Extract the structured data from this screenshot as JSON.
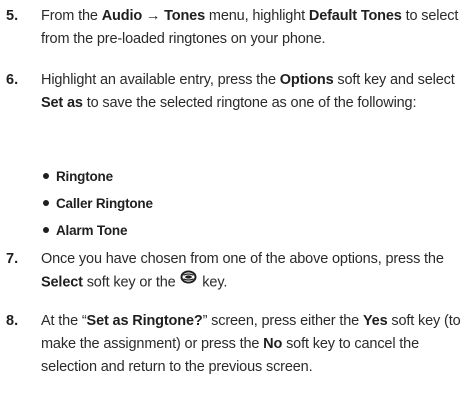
{
  "steps": [
    {
      "number": "5.",
      "t1": "From the ",
      "b1": "Audio → Tones",
      "t2": " menu, highlight ",
      "b2": "Default Tones",
      "t3": " to select from the pre-loaded ringtones on your phone."
    },
    {
      "number": "6.",
      "t1": "Highlight an available entry, press the ",
      "b1": "Options",
      "t2": " soft key and select ",
      "b2": "Set as",
      "t3": " to save the selected ringtone as one of the following:"
    },
    {
      "number": "7.",
      "t1": "Once you have chosen from one of the above options, press the ",
      "b1": "Select",
      "t2": " soft key or the ",
      "t3": " key."
    },
    {
      "number": "8.",
      "t1": "At the “",
      "b1": "Set as Ringtone?",
      "t2": "” screen, press either the ",
      "b2": "Yes",
      "t3": " soft key (to make the assignment) or press the ",
      "b3": "No",
      "t4": " soft key to cancel the selection and return to the previous screen."
    }
  ],
  "options": [
    "Ringtone",
    "Caller Ringtone",
    "Alarm Tone"
  ],
  "icons": {
    "select_key": "center-select-key-icon"
  }
}
